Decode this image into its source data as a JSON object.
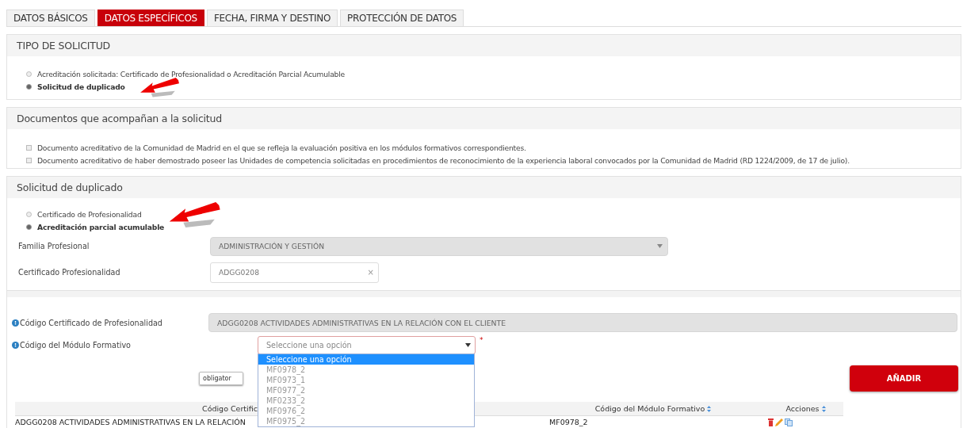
{
  "tabs": [
    {
      "label": "DATOS BÁSICOS",
      "selected": false
    },
    {
      "label": "DATOS ESPECÍFICOS",
      "selected": true
    },
    {
      "label": "FECHA, FIRMA Y DESTINO",
      "selected": false
    },
    {
      "label": "PROTECCIÓN DE DATOS",
      "selected": false
    }
  ],
  "tipo_solicitud": {
    "title": "TIPO DE SOLICITUD",
    "options": [
      {
        "label": "Acreditación solicitada: Certificado de Profesionalidad o Acreditación Parcial Acumulable",
        "selected": false
      },
      {
        "label": "Solicitud de duplicado",
        "selected": true
      }
    ]
  },
  "documentos": {
    "title": "Documentos que acompañan a la solicitud",
    "items": [
      {
        "label": "Documento acreditativo de la Comunidad de Madrid en el que se refleja la evaluación positiva en los módulos formativos correspondientes.",
        "checked": false
      },
      {
        "label": "Documento acreditativo de haber demostrado poseer las Unidades de competencia solicitadas en procedimientos de reconocimiento de la experiencia laboral convocados por la Comunidad de Madrid (RD 1224/2009, de 17 de julio).",
        "checked": false
      }
    ]
  },
  "solicitud_duplicado": {
    "title": "Solicitud de duplicado",
    "options": [
      {
        "label": "Certificado de Profesionalidad",
        "selected": false
      },
      {
        "label": "Acreditación parcial acumulable",
        "selected": true
      }
    ],
    "fields": [
      {
        "label": "Familia Profesional",
        "kind": "select",
        "value": "ADMINISTRACIÓN Y GESTIÓN",
        "disabled": true
      },
      {
        "label": "Certificado Profesionalidad",
        "kind": "clearable",
        "value": "ADGG0208",
        "clear": "×"
      }
    ]
  },
  "modulo": {
    "fields": [
      {
        "label": "Código Certificado de Profesionalidad",
        "kind": "readonly",
        "value": "ADGG0208 ACTIVIDADES ADMINISTRATIVAS EN LA RELACIÓN CON EL CLIENTE"
      },
      {
        "label": "Código del Módulo Formativo",
        "kind": "select",
        "placeholder": "Seleccione una opción",
        "required": "*",
        "expanded": true,
        "options": [
          {
            "label": "Seleccione una opción",
            "selected": true
          },
          {
            "label": "MF0978_2",
            "selected": false
          },
          {
            "label": "MF0973_1",
            "selected": false
          },
          {
            "label": "MF0977_2",
            "selected": false
          },
          {
            "label": "MF0233_2",
            "selected": false
          },
          {
            "label": "MF0976_2",
            "selected": false
          },
          {
            "label": "MF0975_2",
            "selected": false
          }
        ]
      }
    ],
    "small_field": {
      "value": "obligator"
    },
    "add_button": "AÑADIR"
  },
  "table": {
    "columns": [
      {
        "label": "Código Certific",
        "sortable": false
      },
      {
        "label": "Código del Módulo Formativo",
        "sortable": true
      },
      {
        "label": "Acciones",
        "sortable": true
      }
    ],
    "rows": [
      {
        "cells": [
          "ADGG0208 ACTIVIDADES ADMINISTRATIVAS EN LA RELACIÓN",
          "MF0978_2"
        ]
      }
    ]
  }
}
